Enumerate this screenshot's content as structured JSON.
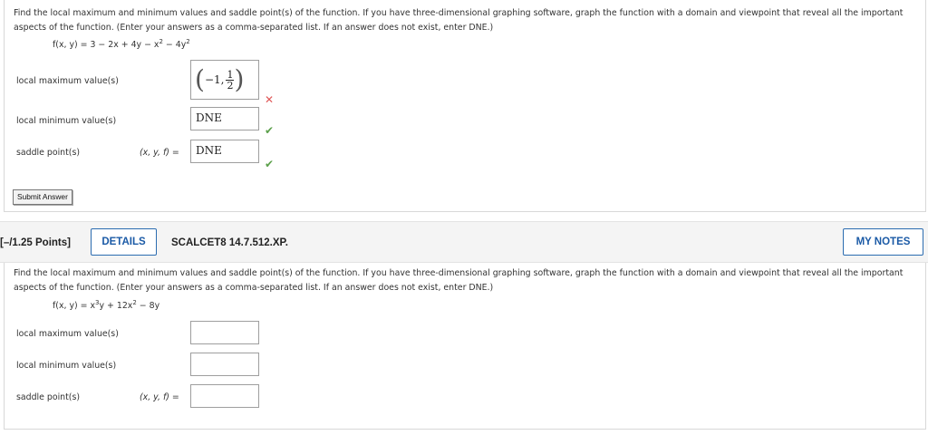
{
  "problem1": {
    "instructions": "Find the local maximum and minimum values and saddle point(s) of the function. If you have three-dimensional graphing software, graph the function with a domain and viewpoint that reveal all the important aspects of the function. (Enter your answers as a comma-separated list. If an answer does not exist, enter DNE.)",
    "function_prefix": "f(x, y) = 3 − 2x + 4y − x",
    "function_mid": " − 4y",
    "exponent": "2",
    "local_max_label": "local maximum value(s)",
    "local_max_answer": {
      "minus_one": "−1,",
      "frac_num": "1",
      "frac_den": "2"
    },
    "local_max_status": "incorrect",
    "local_min_label": "local minimum value(s)",
    "local_min_answer": "DNE",
    "local_min_status": "correct",
    "saddle_label": "saddle point(s)",
    "saddle_prefix": "(x, y, f)",
    "equals": "=",
    "saddle_answer": "DNE",
    "saddle_status": "correct",
    "submit_label": "Submit Answer",
    "incorrect_mark": "✕",
    "correct_mark": "✔"
  },
  "problem2_header": {
    "points": "[–/1.25 Points]",
    "details_label": "DETAILS",
    "course_code": "SCALCET8 14.7.512.XP.",
    "notes_label": "MY NOTES"
  },
  "problem2": {
    "instructions": "Find the local maximum and minimum values and saddle point(s) of the function. If you have three-dimensional graphing software, graph the function with a domain and viewpoint that reveal all the important aspects of the function. (Enter your answers as a comma-separated list. If an answer does not exist, enter DNE.)",
    "function_prefix": "f(x, y) = x",
    "exp3": "3",
    "function_mid": "y + 12x",
    "exp2": "2",
    "function_suffix": " − 8y",
    "local_max_label": "local maximum value(s)",
    "local_max_value": "",
    "local_min_label": "local minimum value(s)",
    "local_min_value": "",
    "saddle_label": "saddle point(s)",
    "saddle_prefix": "(x, y, f)",
    "equals": "=",
    "saddle_value": ""
  },
  "colors": {
    "link_blue": "#1b5aa6",
    "correct_green": "#5ca04b",
    "incorrect_red": "#e05757"
  }
}
